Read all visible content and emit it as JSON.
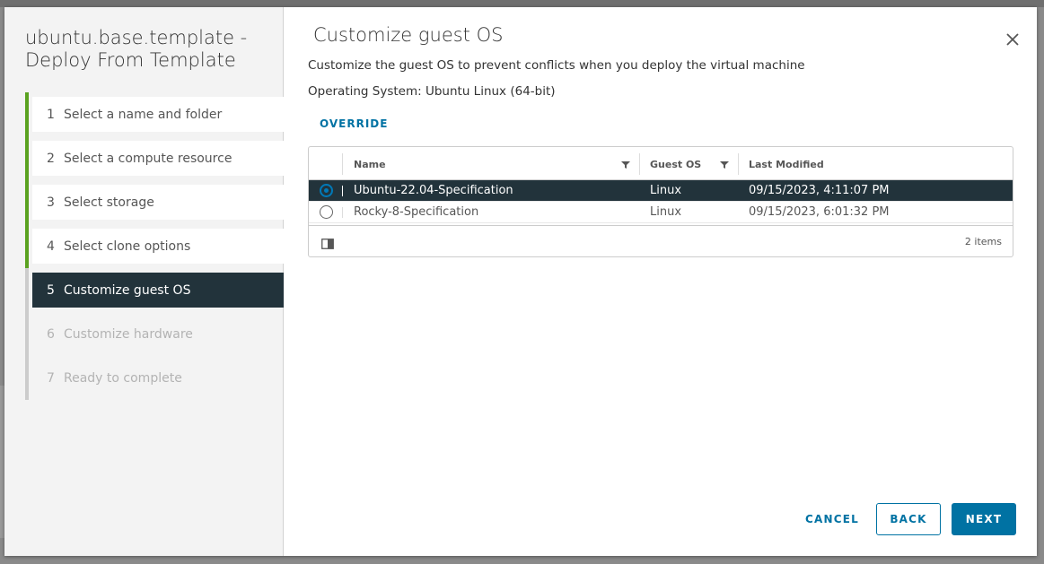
{
  "wizard": {
    "title": "ubuntu.base.template - Deploy From Template",
    "steps": [
      {
        "num": "1",
        "label": "Select a name and folder"
      },
      {
        "num": "2",
        "label": "Select a compute resource"
      },
      {
        "num": "3",
        "label": "Select storage"
      },
      {
        "num": "4",
        "label": "Select clone options"
      },
      {
        "num": "5",
        "label": "Customize guest OS"
      },
      {
        "num": "6",
        "label": "Customize hardware"
      },
      {
        "num": "7",
        "label": "Ready to complete"
      }
    ]
  },
  "page": {
    "title": "Customize guest OS",
    "description": "Customize the guest OS to prevent conflicts when you deploy the virtual machine",
    "os_line": "Operating System: Ubuntu Linux (64-bit)",
    "override_label": "OVERRIDE"
  },
  "grid": {
    "columns": {
      "name": "Name",
      "guest_os": "Guest OS",
      "last_modified": "Last Modified"
    },
    "rows": [
      {
        "name": "Ubuntu-22.04-Specification",
        "guest_os": "Linux",
        "last_modified": "09/15/2023, 4:11:07 PM",
        "selected": true
      },
      {
        "name": "Rocky-8-Specification",
        "guest_os": "Linux",
        "last_modified": "09/15/2023, 6:01:32 PM",
        "selected": false
      }
    ],
    "item_count": "2 items"
  },
  "buttons": {
    "cancel": "CANCEL",
    "back": "BACK",
    "next": "NEXT"
  },
  "colors": {
    "accent": "#0072a3",
    "selected_row": "#22333b",
    "complete_step": "#5aa220"
  },
  "icons": {
    "close": "close-icon",
    "filter": "filter-icon",
    "columns": "column-toggle-icon"
  }
}
